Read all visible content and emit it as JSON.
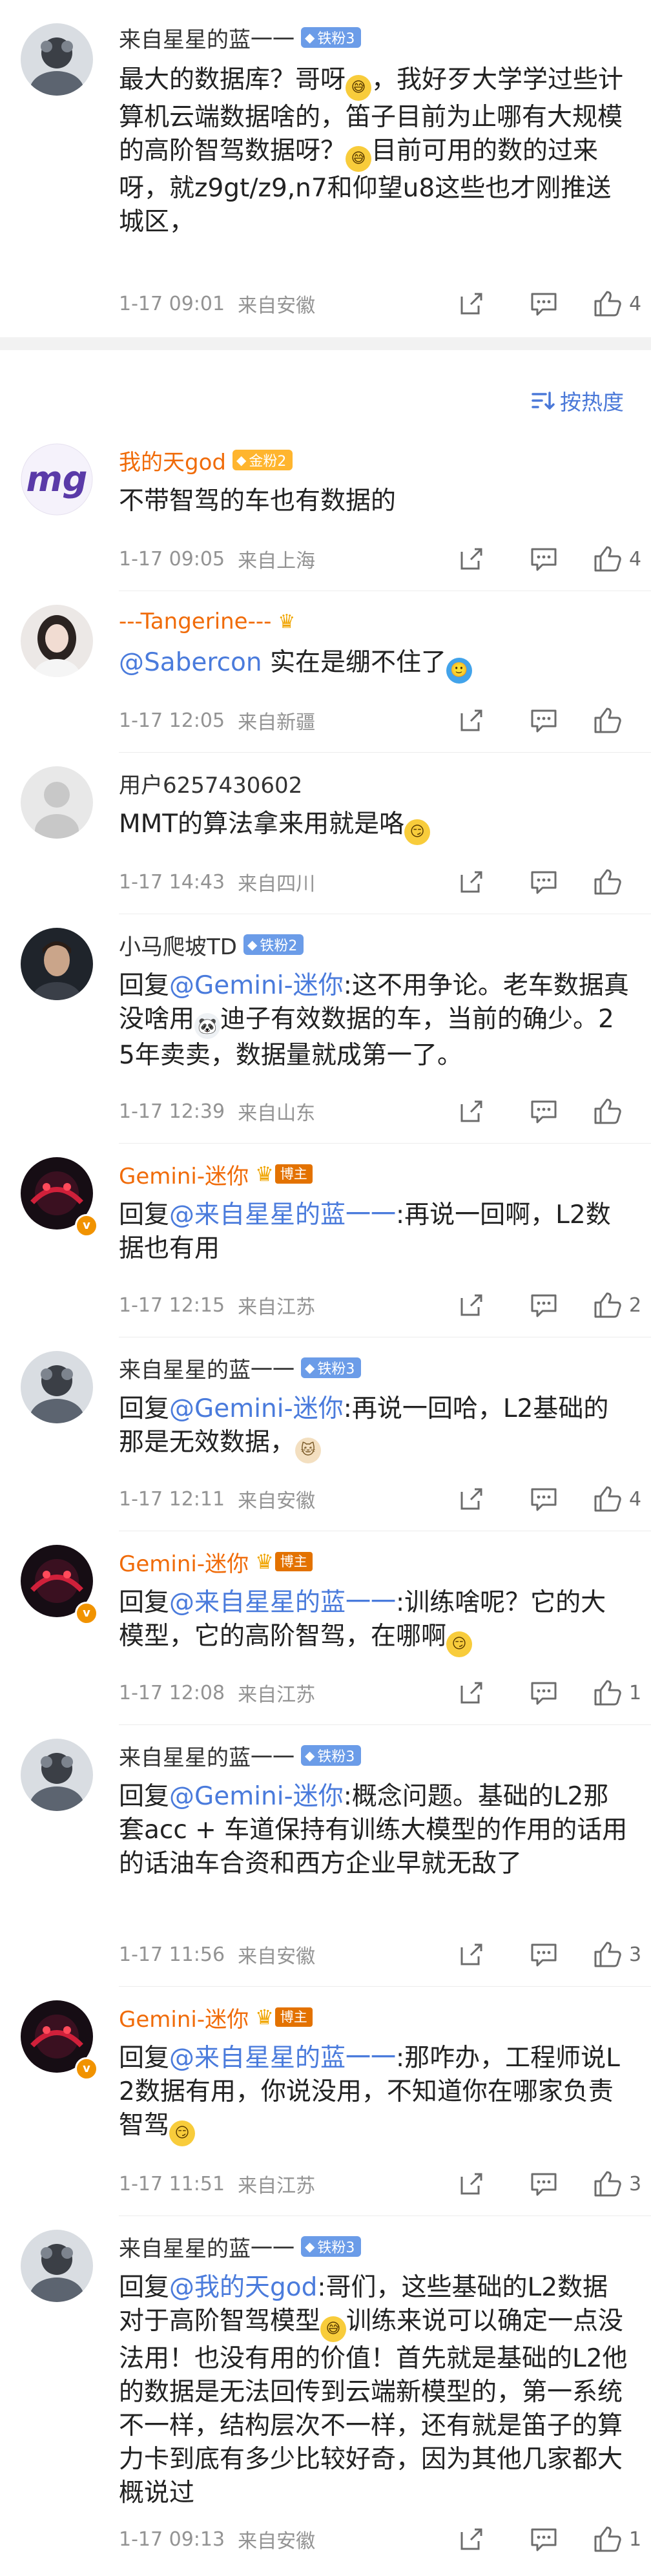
{
  "top_comment": {
    "username": "来自星星的蓝一一",
    "fan_badge": "铁粉3",
    "text_parts": [
      {
        "t": "最大的数据库？哥呀"
      },
      {
        "emo": "sweat"
      },
      {
        "t": "，我好歹大学学过些计算机云端数据啥的，笛子目前为止哪有大规模的高阶智驾数据呀？"
      },
      {
        "emo": "sweat"
      },
      {
        "t": "目前可用的数的过来呀，就z9gt/z9,n7和仰望u8这些也才刚推送城区，"
      }
    ],
    "time": "1-17 09:01",
    "location": "来自安徽",
    "likes": "4"
  },
  "sort": {
    "label": "按热度"
  },
  "replies": [
    {
      "username": "我的天god",
      "name_style": "orange",
      "badge": "金粉2",
      "badge_style": "gold",
      "avatar": "logo",
      "text_parts": [
        {
          "t": "不带智驾的车也有数据的"
        }
      ],
      "time": "1-17 09:05",
      "location": "来自上海",
      "likes": "4"
    },
    {
      "username": "---Tangerine---",
      "name_style": "orange",
      "badge": "",
      "crown_small": true,
      "avatar": "girl",
      "text_parts": [
        {
          "m": "@Sabercon"
        },
        {
          "t": " 实在是绷不住了"
        },
        {
          "emo": "blue"
        }
      ],
      "time": "1-17 12:05",
      "location": "来自新疆",
      "likes": ""
    },
    {
      "username": "用户6257430602",
      "name_style": "",
      "badge": "",
      "avatar": "blank",
      "text_parts": [
        {
          "t": "MMT的算法拿来用就是咯"
        },
        {
          "emo": "smirk"
        }
      ],
      "time": "1-17 14:43",
      "location": "来自四川",
      "likes": ""
    },
    {
      "username": "小马爬坡TD",
      "name_style": "",
      "badge": "铁粉2",
      "avatar": "man",
      "text_parts": [
        {
          "t": "回复"
        },
        {
          "m": "@Gemini-迷你"
        },
        {
          "t": ":这不用争论。老车数据真没啥用"
        },
        {
          "emo": "bear"
        },
        {
          "t": "迪子有效数据的车，当前的确少。25年卖卖，数据量就成第一了。"
        }
      ],
      "time": "1-17 12:39",
      "location": "来自山东",
      "likes": ""
    },
    {
      "username": "Gemini-迷你",
      "name_style": "orange",
      "badge": "博主",
      "badge_style": "boss",
      "avatar": "red",
      "verified": true,
      "text_parts": [
        {
          "t": "回复"
        },
        {
          "m": "@来自星星的蓝一一"
        },
        {
          "t": ":再说一回啊，L2数据也有用"
        }
      ],
      "time": "1-17 12:15",
      "location": "来自江苏",
      "likes": "2"
    },
    {
      "username": "来自星星的蓝一一",
      "name_style": "",
      "badge": "铁粉3",
      "avatar": "cat",
      "text_parts": [
        {
          "t": "回复"
        },
        {
          "m": "@Gemini-迷你"
        },
        {
          "t": ":再说一回哈，L2基础的那是无效数据，"
        },
        {
          "emo": "cat"
        }
      ],
      "time": "1-17 12:11",
      "location": "来自安徽",
      "likes": "4"
    },
    {
      "username": "Gemini-迷你",
      "name_style": "orange",
      "badge": "博主",
      "badge_style": "boss",
      "avatar": "red",
      "verified": true,
      "text_parts": [
        {
          "t": "回复"
        },
        {
          "m": "@来自星星的蓝一一"
        },
        {
          "t": ":训练啥呢？它的大模型，它的高阶智驾，在哪啊"
        },
        {
          "emo": "smirk"
        }
      ],
      "time": "1-17 12:08",
      "location": "来自江苏",
      "likes": "1"
    },
    {
      "username": "来自星星的蓝一一",
      "name_style": "",
      "badge": "铁粉3",
      "avatar": "cat",
      "text_parts": [
        {
          "t": "回复"
        },
        {
          "m": "@Gemini-迷你"
        },
        {
          "t": ":概念问题。基础的L2那套acc + 车道保持有训练大模型的作用的话用的话油车合资和西方企业早就无敌了"
        }
      ],
      "time": "1-17 11:56",
      "location": "来自安徽",
      "likes": "3"
    },
    {
      "username": "Gemini-迷你",
      "name_style": "orange",
      "badge": "博主",
      "badge_style": "boss",
      "avatar": "red",
      "verified": true,
      "text_parts": [
        {
          "t": "回复"
        },
        {
          "m": "@来自星星的蓝一一"
        },
        {
          "t": ":那咋办，工程师说L2数据有用，你说没用，不知道你在哪家负责智驾"
        },
        {
          "emo": "smirk"
        }
      ],
      "time": "1-17 11:51",
      "location": "来自江苏",
      "likes": "3"
    },
    {
      "username": "来自星星的蓝一一",
      "name_style": "",
      "badge": "铁粉3",
      "avatar": "cat",
      "text_parts": [
        {
          "t": "回复"
        },
        {
          "m": "@我的天god"
        },
        {
          "t": ":哥们，这些基础的L2数据对于高阶智驾模型"
        },
        {
          "emo": "sweat"
        },
        {
          "t": "训练来说可以确定一点没法用！也没有用的价值！首先就是基础的L2他的数据是无法回传到云端新模型的，第一系统不一样，结构层次不一样，还有就是笛子的算力卡到底有多少比较好奇，因为其他几家都大概说过"
        }
      ],
      "time": "1-17 09:13",
      "location": "来自安徽",
      "likes": "1"
    }
  ],
  "emoji_glyphs": {
    "sweat": "😅",
    "bear": "🐼",
    "blue": "🙂",
    "smirk": "😏",
    "cat": "🐱"
  },
  "colors": {
    "accent": "#4a7bdc",
    "vip_name": "#f06b09",
    "meta": "#939393",
    "fan_badge": "#6b9ce8",
    "boss_badge": "#e37200"
  }
}
